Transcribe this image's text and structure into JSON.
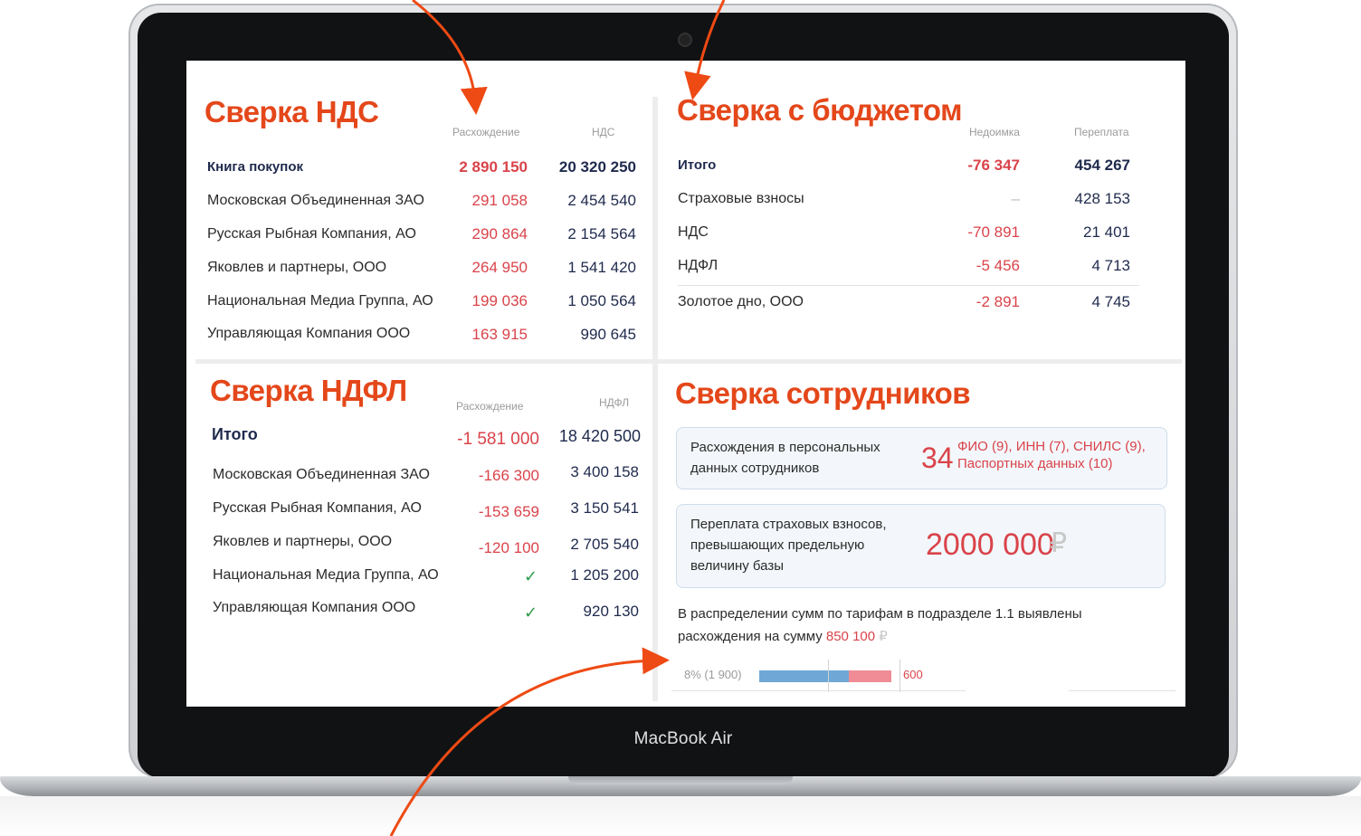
{
  "device": {
    "brand": "MacBook Air"
  },
  "colors": {
    "accent": "#e4471a",
    "negative": "#d9434a",
    "dark_text": "#1f2a4d",
    "ok": "#2e9a4b",
    "arrow": "#ee4a14"
  },
  "vat": {
    "title": "Сверка НДС",
    "col_diff": "Расхождение",
    "col_vat": "НДС",
    "rows": [
      {
        "name": "Книга покупок",
        "diff": "2 890 150",
        "vat": "20 320 250"
      },
      {
        "name": "Московская Объединенная  ЗАО",
        "diff": "291 058",
        "vat": "2 454 540"
      },
      {
        "name": "Русская Рыбная Компания, АО",
        "diff": "290 864",
        "vat": "2 154 564"
      },
      {
        "name": "Яковлев и партнеры, ООО",
        "diff": "264 950",
        "vat": "1 541 420"
      },
      {
        "name": "Национальная Медиа Группа, АО",
        "diff": "199 036",
        "vat": "1 050 564"
      },
      {
        "name": "Управляющая Компания ООО",
        "diff": "163 915",
        "vat": "990 645"
      }
    ]
  },
  "budget": {
    "title": "Сверка с бюджетом",
    "col_arrears": "Недоимка",
    "col_overpay": "Переплата",
    "rows": [
      {
        "name": "Итого",
        "arrears": "-76 347",
        "overpay": "454 267"
      },
      {
        "name": "Страховые взносы",
        "arrears": "–",
        "overpay": "428 153"
      },
      {
        "name": "НДС",
        "arrears": "-70 891",
        "overpay": "21 401"
      },
      {
        "name": "НДФЛ",
        "arrears": "-5 456",
        "overpay": "4 713"
      },
      {
        "name": "Золотое дно, ООО",
        "arrears": "-2 891",
        "overpay": "4 745"
      }
    ]
  },
  "ndfl": {
    "title": "Сверка НДФЛ",
    "col_diff": "Расхождение",
    "col_ndfl": "НДФЛ",
    "rows": [
      {
        "name": "Итого",
        "diff": "-1 581 000",
        "ndfl": "18 420 500"
      },
      {
        "name": "Московская Объединенная  ЗАО",
        "diff": "-166 300",
        "ndfl": "3 400 158"
      },
      {
        "name": "Русская Рыбная Компания, АО",
        "diff": "-153 659",
        "ndfl": "3 150 541"
      },
      {
        "name": "Яковлев и партнеры, ООО",
        "diff": "-120 100",
        "ndfl": "2 705 540"
      },
      {
        "name": "Национальная Медиа Группа, АО",
        "diff": "✓",
        "ndfl": "1 205 200"
      },
      {
        "name": "Управляющая Компания ООО",
        "diff": "✓",
        "ndfl": "920 130"
      }
    ]
  },
  "employees": {
    "title": "Сверка сотрудников",
    "card1": {
      "text": "Расхождения в персональных данных сотрудников",
      "count": "34",
      "detail_line1": "ФИО (9), ИНН (7), СНИЛС (9),",
      "detail_line2": "Паспортных данных (10)"
    },
    "card2": {
      "text": "Переплата страховых взносов, превышающих предельную величину базы",
      "amount": "2000 000",
      "currency": "₽"
    },
    "note": {
      "line1": "В распределении сумм по тарифам в подразделе 1.1 выявлены",
      "line2_prefix": "расхождения на сумму",
      "amount": "850 100",
      "currency": "₽"
    },
    "bar": {
      "label_left": "8% (1 900)",
      "label_right": "600",
      "blue_fraction": 0.68
    }
  }
}
